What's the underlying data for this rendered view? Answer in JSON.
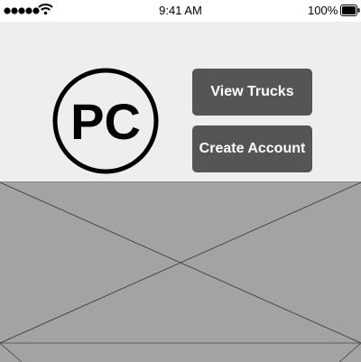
{
  "status_bar": {
    "time": "9:41 AM",
    "battery_percent": "100%",
    "signal_bars": 5,
    "signal_icon": "signal-dots-icon",
    "wifi_icon": "wifi-icon",
    "battery_icon": "battery-icon"
  },
  "header": {
    "logo_text": "PC",
    "buttons": {
      "view_trucks": "View Trucks",
      "create_account": "Create Account"
    }
  },
  "placeholder": {
    "icon": "image-placeholder-icon"
  },
  "colors": {
    "header_bg": "#eeeeee",
    "button_bg": "#555555",
    "button_text": "#ffffff",
    "placeholder_bg": "#a3a3a3"
  }
}
